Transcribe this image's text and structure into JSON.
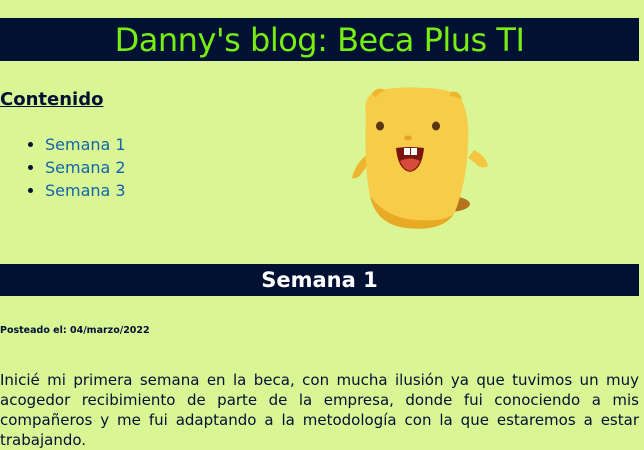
{
  "colors": {
    "page_background": "#d9f594",
    "header_background": "#001133",
    "header_title": "#77ee11",
    "link": "#1166aa",
    "section_title": "#ffffff",
    "text": "#001133"
  },
  "header": {
    "title": "Danny's blog: Beca Plus TI"
  },
  "contents": {
    "heading": "Contenido",
    "items": [
      {
        "label": "Semana 1"
      },
      {
        "label": "Semana 2"
      },
      {
        "label": "Semana 3"
      }
    ]
  },
  "mascot": {
    "icon": "yellow-monster-mascot"
  },
  "post": {
    "title": "Semana 1",
    "date": "Posteado el: 04/marzo/2022",
    "body": "Inicié mi primera semana en la beca, con mucha ilusión ya que tuvimos un muy acogedor recibimiento de parte de la empresa, donde fui conociendo a mis compañeros y me fui adaptando a la metodología con la que estaremos a estar trabajando."
  }
}
